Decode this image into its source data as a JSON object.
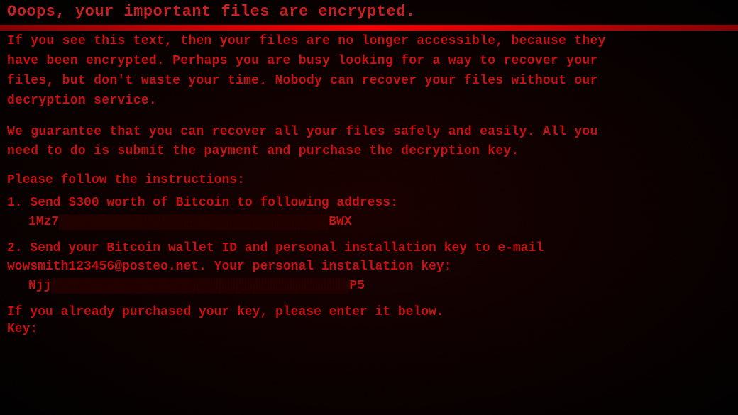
{
  "screen": {
    "top_text": "Ooops, your important files are encrypted.",
    "red_bar": "---",
    "paragraph1": "If you see this text, then your files are no longer accessible, because they\nhave been encrypted.  Perhaps you are busy looking for a way to recover your\nfiles, but don't waste your time.  Nobody can recover your files without our\ndecryption service.",
    "paragraph2": "We guarantee that you can recover all your files safely and easily.  All you\nneed to do is submit the payment and purchase the decryption key.",
    "instructions_header": "Please follow the instructions:",
    "step1_label": "1.  Send $300 worth of Bitcoin to following address:",
    "bitcoin_address_start": "1Mz7",
    "bitcoin_address_end": "BWX",
    "step2_label": "2.  Send your Bitcoin wallet ID and personal installation key to e-mail",
    "step2_email": "     wowsmith123456@posteo.net.  Your personal installation key:",
    "install_key_start": "Njj",
    "install_key_end": "P5",
    "enter_key_text": "If you already purchased your key, please enter it below.",
    "key_prompt": "Key:"
  }
}
